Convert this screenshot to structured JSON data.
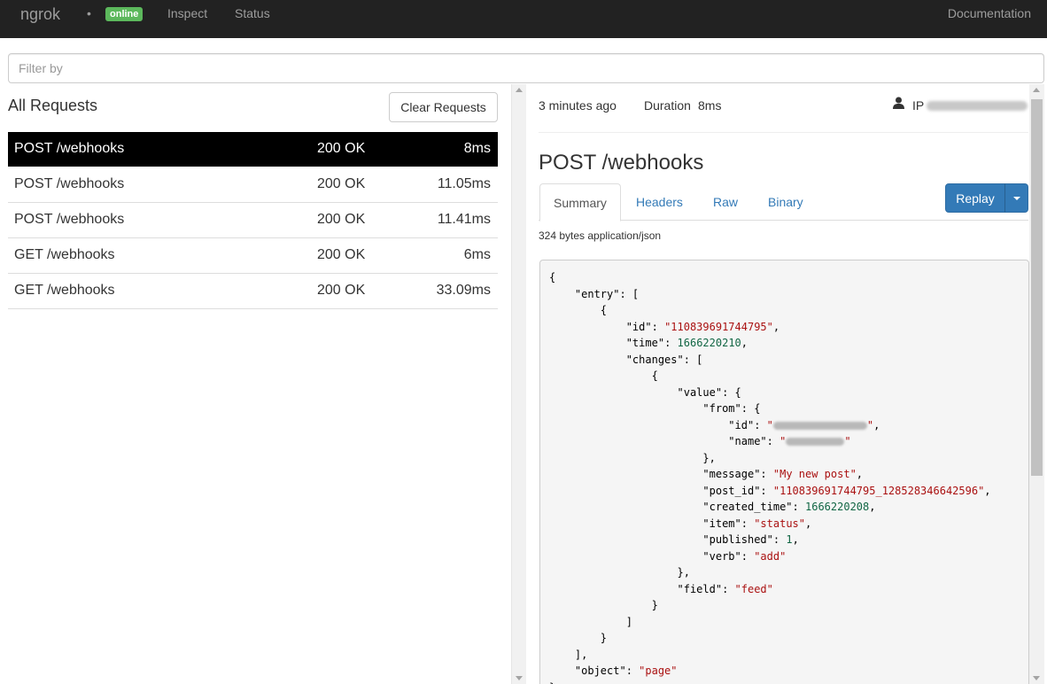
{
  "nav": {
    "brand": "ngrok",
    "dot": "•",
    "status_badge": "online",
    "inspect": "Inspect",
    "status": "Status",
    "documentation": "Documentation"
  },
  "filter": {
    "placeholder": "Filter by"
  },
  "requests_panel": {
    "title": "All Requests",
    "clear_label": "Clear Requests",
    "rows": [
      {
        "path": "POST /webhooks",
        "status": "200 OK",
        "duration": "8ms",
        "selected": true
      },
      {
        "path": "POST /webhooks",
        "status": "200 OK",
        "duration": "11.05ms"
      },
      {
        "path": "POST /webhooks",
        "status": "200 OK",
        "duration": "11.41ms"
      },
      {
        "path": "GET /webhooks",
        "status": "200 OK",
        "duration": "6ms"
      },
      {
        "path": "GET /webhooks",
        "status": "200 OK",
        "duration": "33.09ms"
      }
    ]
  },
  "detail": {
    "time_ago": "3 minutes ago",
    "duration_label": "Duration",
    "duration_value": "8ms",
    "ip_label": "IP",
    "title": "POST /webhooks",
    "tabs": [
      "Summary",
      "Headers",
      "Raw",
      "Binary"
    ],
    "active_tab": "Summary",
    "replay_label": "Replay",
    "body_meta": "324 bytes application/json",
    "json": {
      "open_brace": "{",
      "entry_key": "\"entry\"",
      "id_key": "\"id\"",
      "id_val": "\"110839691744795\"",
      "time_key": "\"time\"",
      "time_val": "1666220210",
      "changes_key": "\"changes\"",
      "value_key": "\"value\"",
      "from_key": "\"from\"",
      "name_key": "\"name\"",
      "message_key": "\"message\"",
      "message_val": "\"My new post\"",
      "post_id_key": "\"post_id\"",
      "post_id_val": "\"110839691744795_128528346642596\"",
      "created_time_key": "\"created_time\"",
      "created_time_val": "1666220208",
      "item_key": "\"item\"",
      "item_val": "\"status\"",
      "published_key": "\"published\"",
      "published_val": "1",
      "verb_key": "\"verb\"",
      "verb_val": "\"add\"",
      "field_key": "\"field\"",
      "field_val": "\"feed\"",
      "object_key": "\"object\"",
      "object_val": "\"page\""
    }
  },
  "colors": {
    "navbar_bg": "#222222",
    "online_badge": "#5cb85c",
    "link_blue": "#337ab7",
    "selected_row_bg": "#000000",
    "json_string": "#aa1111",
    "json_number": "#116644"
  }
}
